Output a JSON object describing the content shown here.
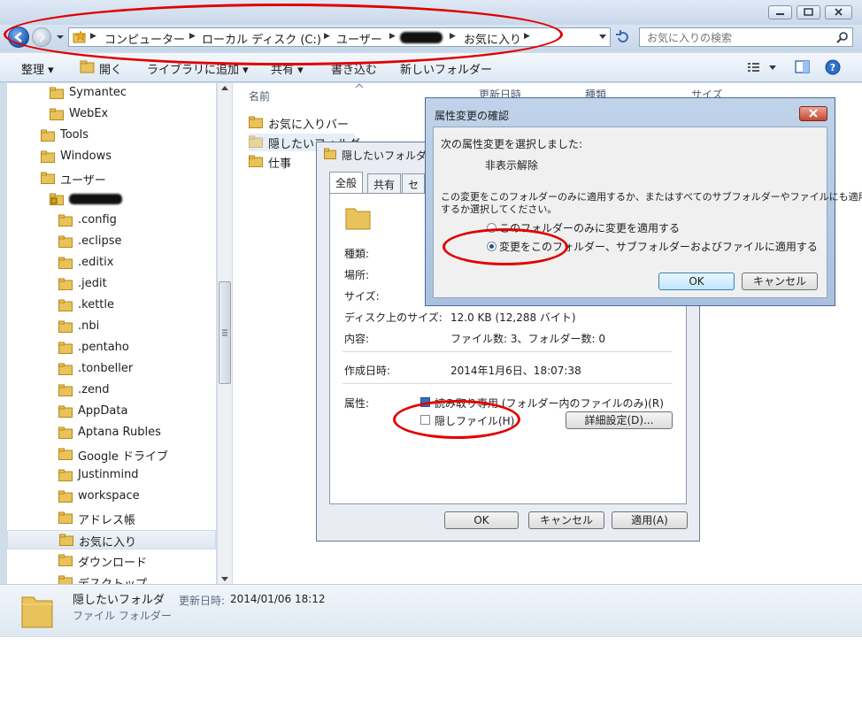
{
  "address": {
    "crumbs": [
      "コンピューター",
      "ローカル ディスク (C:)",
      "ユーザー",
      "お気に入り"
    ]
  },
  "search": {
    "placeholder": "お気に入りの検索"
  },
  "toolbar": {
    "organize": "整理 ▾",
    "open": "開く",
    "add_to_library": "ライブラリに追加 ▾",
    "share": "共有 ▾",
    "burn": "書き込む",
    "new_folder": "新しいフォルダー"
  },
  "nav": {
    "items": [
      {
        "label": "Symantec",
        "indent": 2
      },
      {
        "label": "WebEx",
        "indent": 2
      },
      {
        "label": "Tools",
        "indent": 1
      },
      {
        "label": "Windows",
        "indent": 1
      },
      {
        "label": "ユーザー",
        "indent": 1
      },
      {
        "label": "",
        "indent": 2,
        "icon": "locked-folder-icon"
      },
      {
        "label": ".config",
        "indent": 3
      },
      {
        "label": ".eclipse",
        "indent": 3
      },
      {
        "label": ".editix",
        "indent": 3
      },
      {
        "label": ".jedit",
        "indent": 3
      },
      {
        "label": ".kettle",
        "indent": 3
      },
      {
        "label": ".nbi",
        "indent": 3
      },
      {
        "label": ".pentaho",
        "indent": 3
      },
      {
        "label": ".tonbeller",
        "indent": 3
      },
      {
        "label": ".zend",
        "indent": 3
      },
      {
        "label": "AppData",
        "indent": 3
      },
      {
        "label": "Aptana Rubles",
        "indent": 3
      },
      {
        "label": "Google ドライブ",
        "indent": 3
      },
      {
        "label": "Justinmind",
        "indent": 3
      },
      {
        "label": "workspace",
        "indent": 3
      },
      {
        "label": "アドレス帳",
        "indent": 3
      },
      {
        "label": "お気に入り",
        "indent": 3,
        "selected": true
      },
      {
        "label": "ダウンロード",
        "indent": 3
      },
      {
        "label": "デスクトップ",
        "indent": 3
      }
    ]
  },
  "content": {
    "columns": [
      "名前",
      "更新日時",
      "種類",
      "サイズ"
    ],
    "items": [
      "お気に入りバー",
      "隠したいフォルダ",
      "仕事"
    ]
  },
  "details": {
    "name": "隠したいフォルダ",
    "modified_label": "更新日時:",
    "modified_value": "2014/01/06 18:12",
    "type": "ファイル フォルダー"
  },
  "properties": {
    "title": "隠したいフォルダ",
    "tabs": [
      "全般",
      "共有",
      "セ"
    ],
    "labels": {
      "type": "種類:",
      "location": "場所:",
      "size": "サイズ:",
      "size_on_disk": "ディスク上のサイズ:",
      "contents": "内容:",
      "created": "作成日時:",
      "attributes": "属性:"
    },
    "values": {
      "size_on_disk": "12.0 KB (12,288 バイト)",
      "contents": "ファイル数: 3、フォルダー数: 0",
      "created": "2014年1月6日、18:07:38"
    },
    "readonly_label": "読み取り専用 (フォルダー内のファイルのみ)(R)",
    "hidden_label": "隠しファイル(H)",
    "advanced_button": "詳細設定(D)...",
    "ok": "OK",
    "cancel": "キャンセル",
    "apply": "適用(A)"
  },
  "confirm": {
    "title": "属性変更の確認",
    "intro": "次の属性変更を選択しました:",
    "change": "非表示解除",
    "question_line1": "この変更をこのフォルダーのみに適用するか、またはすべてのサブフォルダーやファイルにも適用",
    "question_line2": "するか選択してください。",
    "option_this_only": "このフォルダーのみに変更を適用する",
    "option_all": "変更をこのフォルダー、サブフォルダーおよびファイルに適用する",
    "selected_option": "all",
    "ok": "OK",
    "cancel": "キャンセル"
  },
  "colors": {
    "folder": "#e8c25a",
    "annotation": "#e00000",
    "accent": "#1f5bb5"
  }
}
